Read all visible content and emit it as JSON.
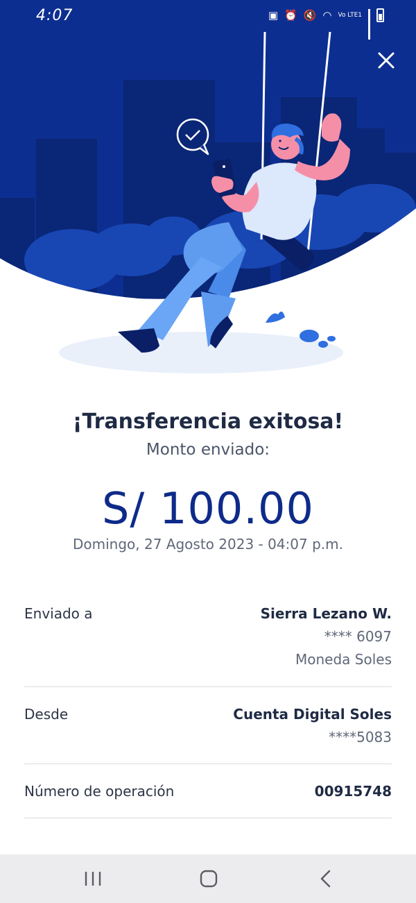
{
  "status_bar": {
    "time": "4:07",
    "network_label": "Vo LTE1"
  },
  "colors": {
    "hero_blue": "#0e2b8a",
    "amount_blue": "#0e2b8a",
    "nav_bar": "#ececee"
  },
  "header": {
    "close_icon": "close-icon"
  },
  "result": {
    "title": "¡Transferencia exitosa!",
    "subtitle": "Monto enviado:",
    "amount": "S/ 100.00",
    "datetime": "Domingo, 27 Agosto 2023 - 04:07 p.m."
  },
  "details": {
    "sent_to": {
      "label": "Enviado a",
      "name": "Sierra Lezano W.",
      "account": "**** 6097",
      "currency": "Moneda Soles"
    },
    "from": {
      "label": "Desde",
      "account_name": "Cuenta Digital Soles",
      "account": "****5083"
    },
    "operation": {
      "label": "Número de operación",
      "number": "00915748"
    }
  },
  "nav_bar": {
    "icons": [
      "recent-apps-icon",
      "home-icon",
      "back-icon"
    ]
  }
}
